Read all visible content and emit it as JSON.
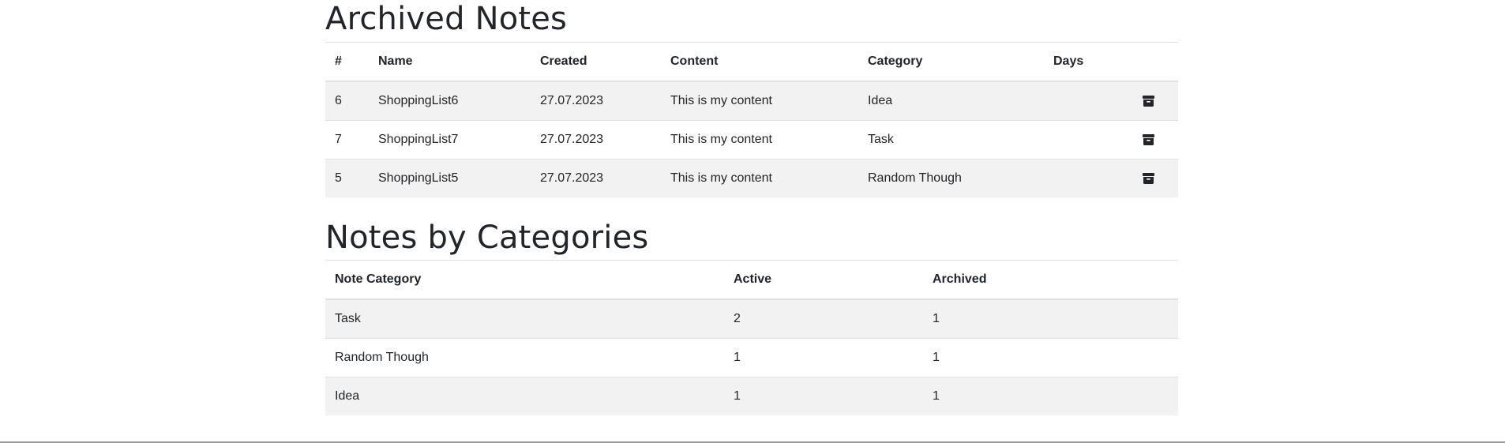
{
  "archived": {
    "title": "Archived Notes",
    "headers": [
      "#",
      "Name",
      "Created",
      "Content",
      "Category",
      "Days"
    ],
    "rows": [
      {
        "id": "6",
        "name": "ShoppingList6",
        "created": "27.07.2023",
        "content": "This is my content",
        "category": "Idea",
        "days": "",
        "action_icon": "archive-icon"
      },
      {
        "id": "7",
        "name": "ShoppingList7",
        "created": "27.07.2023",
        "content": "This is my content",
        "category": "Task",
        "days": "",
        "action_icon": "archive-icon"
      },
      {
        "id": "5",
        "name": "ShoppingList5",
        "created": "27.07.2023",
        "content": "This is my content",
        "category": "Random Though",
        "days": "",
        "action_icon": "archive-icon"
      }
    ]
  },
  "categories": {
    "title": "Notes by Categories",
    "headers": [
      "Note Category",
      "Active",
      "Archived"
    ],
    "rows": [
      {
        "category": "Task",
        "active": "2",
        "archived": "1"
      },
      {
        "category": "Random Though",
        "active": "1",
        "archived": "1"
      },
      {
        "category": "Idea",
        "active": "1",
        "archived": "1"
      }
    ]
  },
  "colors": {
    "text": "#212529",
    "stripe": "#f2f2f2",
    "border": "#dee2e6",
    "icon": "#212529"
  }
}
